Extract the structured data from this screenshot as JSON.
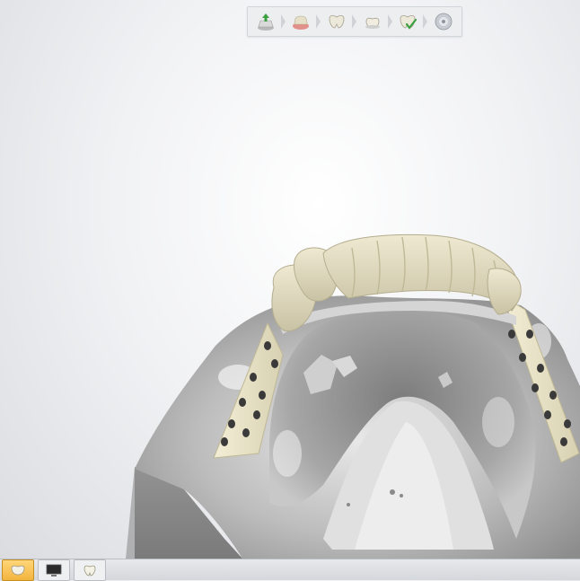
{
  "toolbar": {
    "steps": [
      {
        "icon": "scan-import-icon",
        "state": "done"
      },
      {
        "icon": "gingiva-icon",
        "state": "done"
      },
      {
        "icon": "tooth-crown-icon",
        "state": "done"
      },
      {
        "icon": "tooth-design-icon",
        "state": "done"
      },
      {
        "icon": "tooth-check-icon",
        "state": "current"
      },
      {
        "icon": "export-disc-icon",
        "state": "pending"
      }
    ]
  },
  "taskbar": {
    "items": [
      {
        "icon": "crown-window-icon",
        "active": true
      },
      {
        "icon": "monitor-window-icon",
        "active": false
      },
      {
        "icon": "tooth-window-icon",
        "active": false
      }
    ]
  },
  "colors": {
    "background": "#f1f2f4",
    "model": "#c9c9c9",
    "teeth": "#e1dbc2",
    "framework": "#ece7cc",
    "accent_green": "#3aa040",
    "taskbar_active": "#f3b43d"
  }
}
